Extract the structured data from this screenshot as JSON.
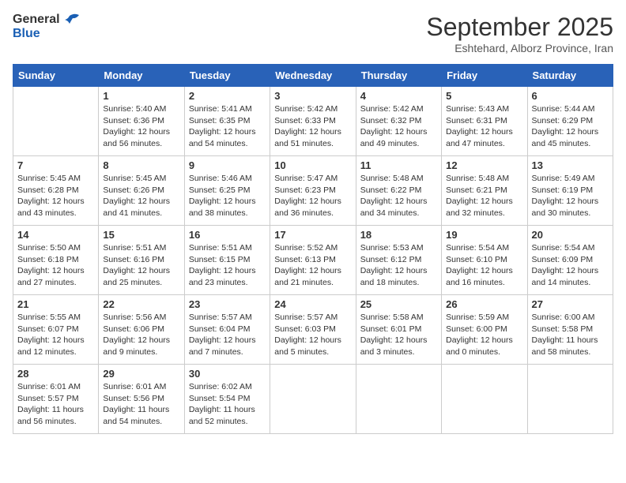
{
  "logo": {
    "line1": "General",
    "line2": "Blue"
  },
  "title": "September 2025",
  "subtitle": "Eshtehard, Alborz Province, Iran",
  "weekdays": [
    "Sunday",
    "Monday",
    "Tuesday",
    "Wednesday",
    "Thursday",
    "Friday",
    "Saturday"
  ],
  "weeks": [
    [
      {
        "day": null,
        "info": null
      },
      {
        "day": "1",
        "sunrise": "5:40 AM",
        "sunset": "6:36 PM",
        "daylight": "12 hours and 56 minutes."
      },
      {
        "day": "2",
        "sunrise": "5:41 AM",
        "sunset": "6:35 PM",
        "daylight": "12 hours and 54 minutes."
      },
      {
        "day": "3",
        "sunrise": "5:42 AM",
        "sunset": "6:33 PM",
        "daylight": "12 hours and 51 minutes."
      },
      {
        "day": "4",
        "sunrise": "5:42 AM",
        "sunset": "6:32 PM",
        "daylight": "12 hours and 49 minutes."
      },
      {
        "day": "5",
        "sunrise": "5:43 AM",
        "sunset": "6:31 PM",
        "daylight": "12 hours and 47 minutes."
      },
      {
        "day": "6",
        "sunrise": "5:44 AM",
        "sunset": "6:29 PM",
        "daylight": "12 hours and 45 minutes."
      }
    ],
    [
      {
        "day": "7",
        "sunrise": "5:45 AM",
        "sunset": "6:28 PM",
        "daylight": "12 hours and 43 minutes."
      },
      {
        "day": "8",
        "sunrise": "5:45 AM",
        "sunset": "6:26 PM",
        "daylight": "12 hours and 41 minutes."
      },
      {
        "day": "9",
        "sunrise": "5:46 AM",
        "sunset": "6:25 PM",
        "daylight": "12 hours and 38 minutes."
      },
      {
        "day": "10",
        "sunrise": "5:47 AM",
        "sunset": "6:23 PM",
        "daylight": "12 hours and 36 minutes."
      },
      {
        "day": "11",
        "sunrise": "5:48 AM",
        "sunset": "6:22 PM",
        "daylight": "12 hours and 34 minutes."
      },
      {
        "day": "12",
        "sunrise": "5:48 AM",
        "sunset": "6:21 PM",
        "daylight": "12 hours and 32 minutes."
      },
      {
        "day": "13",
        "sunrise": "5:49 AM",
        "sunset": "6:19 PM",
        "daylight": "12 hours and 30 minutes."
      }
    ],
    [
      {
        "day": "14",
        "sunrise": "5:50 AM",
        "sunset": "6:18 PM",
        "daylight": "12 hours and 27 minutes."
      },
      {
        "day": "15",
        "sunrise": "5:51 AM",
        "sunset": "6:16 PM",
        "daylight": "12 hours and 25 minutes."
      },
      {
        "day": "16",
        "sunrise": "5:51 AM",
        "sunset": "6:15 PM",
        "daylight": "12 hours and 23 minutes."
      },
      {
        "day": "17",
        "sunrise": "5:52 AM",
        "sunset": "6:13 PM",
        "daylight": "12 hours and 21 minutes."
      },
      {
        "day": "18",
        "sunrise": "5:53 AM",
        "sunset": "6:12 PM",
        "daylight": "12 hours and 18 minutes."
      },
      {
        "day": "19",
        "sunrise": "5:54 AM",
        "sunset": "6:10 PM",
        "daylight": "12 hours and 16 minutes."
      },
      {
        "day": "20",
        "sunrise": "5:54 AM",
        "sunset": "6:09 PM",
        "daylight": "12 hours and 14 minutes."
      }
    ],
    [
      {
        "day": "21",
        "sunrise": "5:55 AM",
        "sunset": "6:07 PM",
        "daylight": "12 hours and 12 minutes."
      },
      {
        "day": "22",
        "sunrise": "5:56 AM",
        "sunset": "6:06 PM",
        "daylight": "12 hours and 9 minutes."
      },
      {
        "day": "23",
        "sunrise": "5:57 AM",
        "sunset": "6:04 PM",
        "daylight": "12 hours and 7 minutes."
      },
      {
        "day": "24",
        "sunrise": "5:57 AM",
        "sunset": "6:03 PM",
        "daylight": "12 hours and 5 minutes."
      },
      {
        "day": "25",
        "sunrise": "5:58 AM",
        "sunset": "6:01 PM",
        "daylight": "12 hours and 3 minutes."
      },
      {
        "day": "26",
        "sunrise": "5:59 AM",
        "sunset": "6:00 PM",
        "daylight": "12 hours and 0 minutes."
      },
      {
        "day": "27",
        "sunrise": "6:00 AM",
        "sunset": "5:58 PM",
        "daylight": "11 hours and 58 minutes."
      }
    ],
    [
      {
        "day": "28",
        "sunrise": "6:01 AM",
        "sunset": "5:57 PM",
        "daylight": "11 hours and 56 minutes."
      },
      {
        "day": "29",
        "sunrise": "6:01 AM",
        "sunset": "5:56 PM",
        "daylight": "11 hours and 54 minutes."
      },
      {
        "day": "30",
        "sunrise": "6:02 AM",
        "sunset": "5:54 PM",
        "daylight": "11 hours and 52 minutes."
      },
      {
        "day": null,
        "info": null
      },
      {
        "day": null,
        "info": null
      },
      {
        "day": null,
        "info": null
      },
      {
        "day": null,
        "info": null
      }
    ]
  ]
}
